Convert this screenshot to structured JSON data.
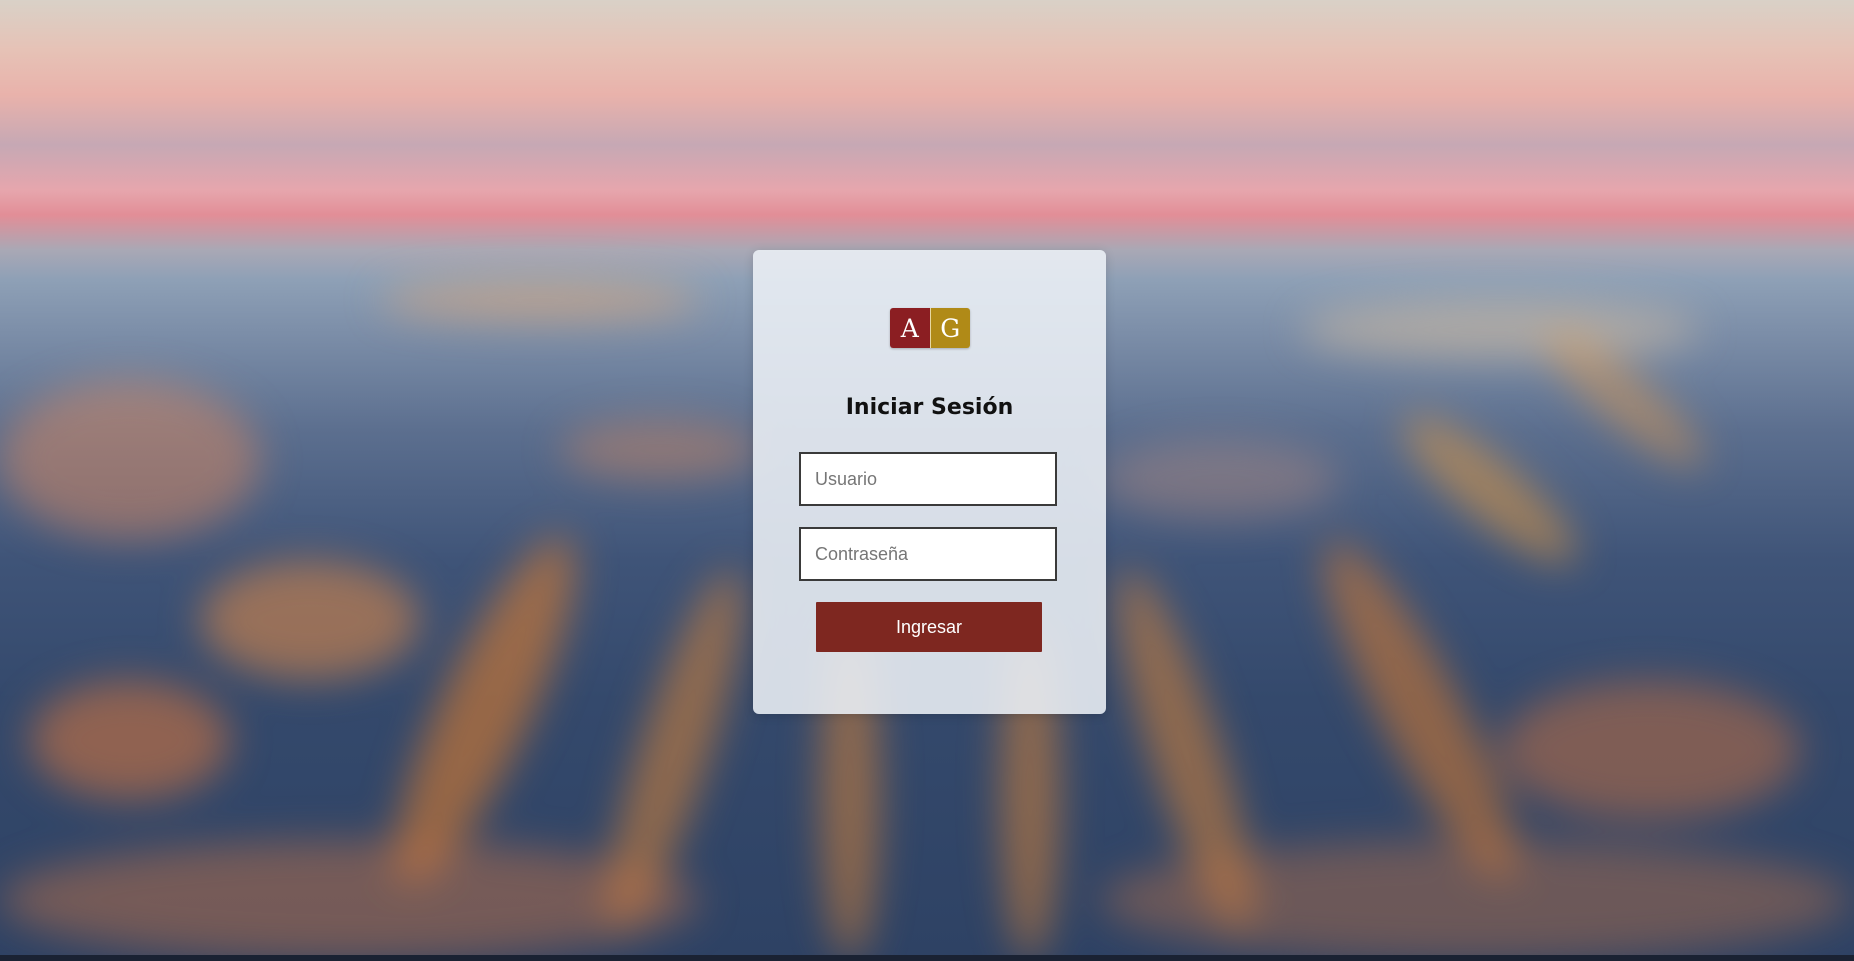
{
  "logo": {
    "left_letter": "A",
    "right_letter": "G",
    "left_color": "#8b1e22",
    "right_color": "#b08a17"
  },
  "login": {
    "title": "Iniciar Sesión",
    "username_placeholder": "Usuario",
    "username_value": "",
    "password_placeholder": "Contraseña",
    "password_value": "",
    "submit_label": "Ingresar",
    "submit_color": "#7e2720"
  }
}
